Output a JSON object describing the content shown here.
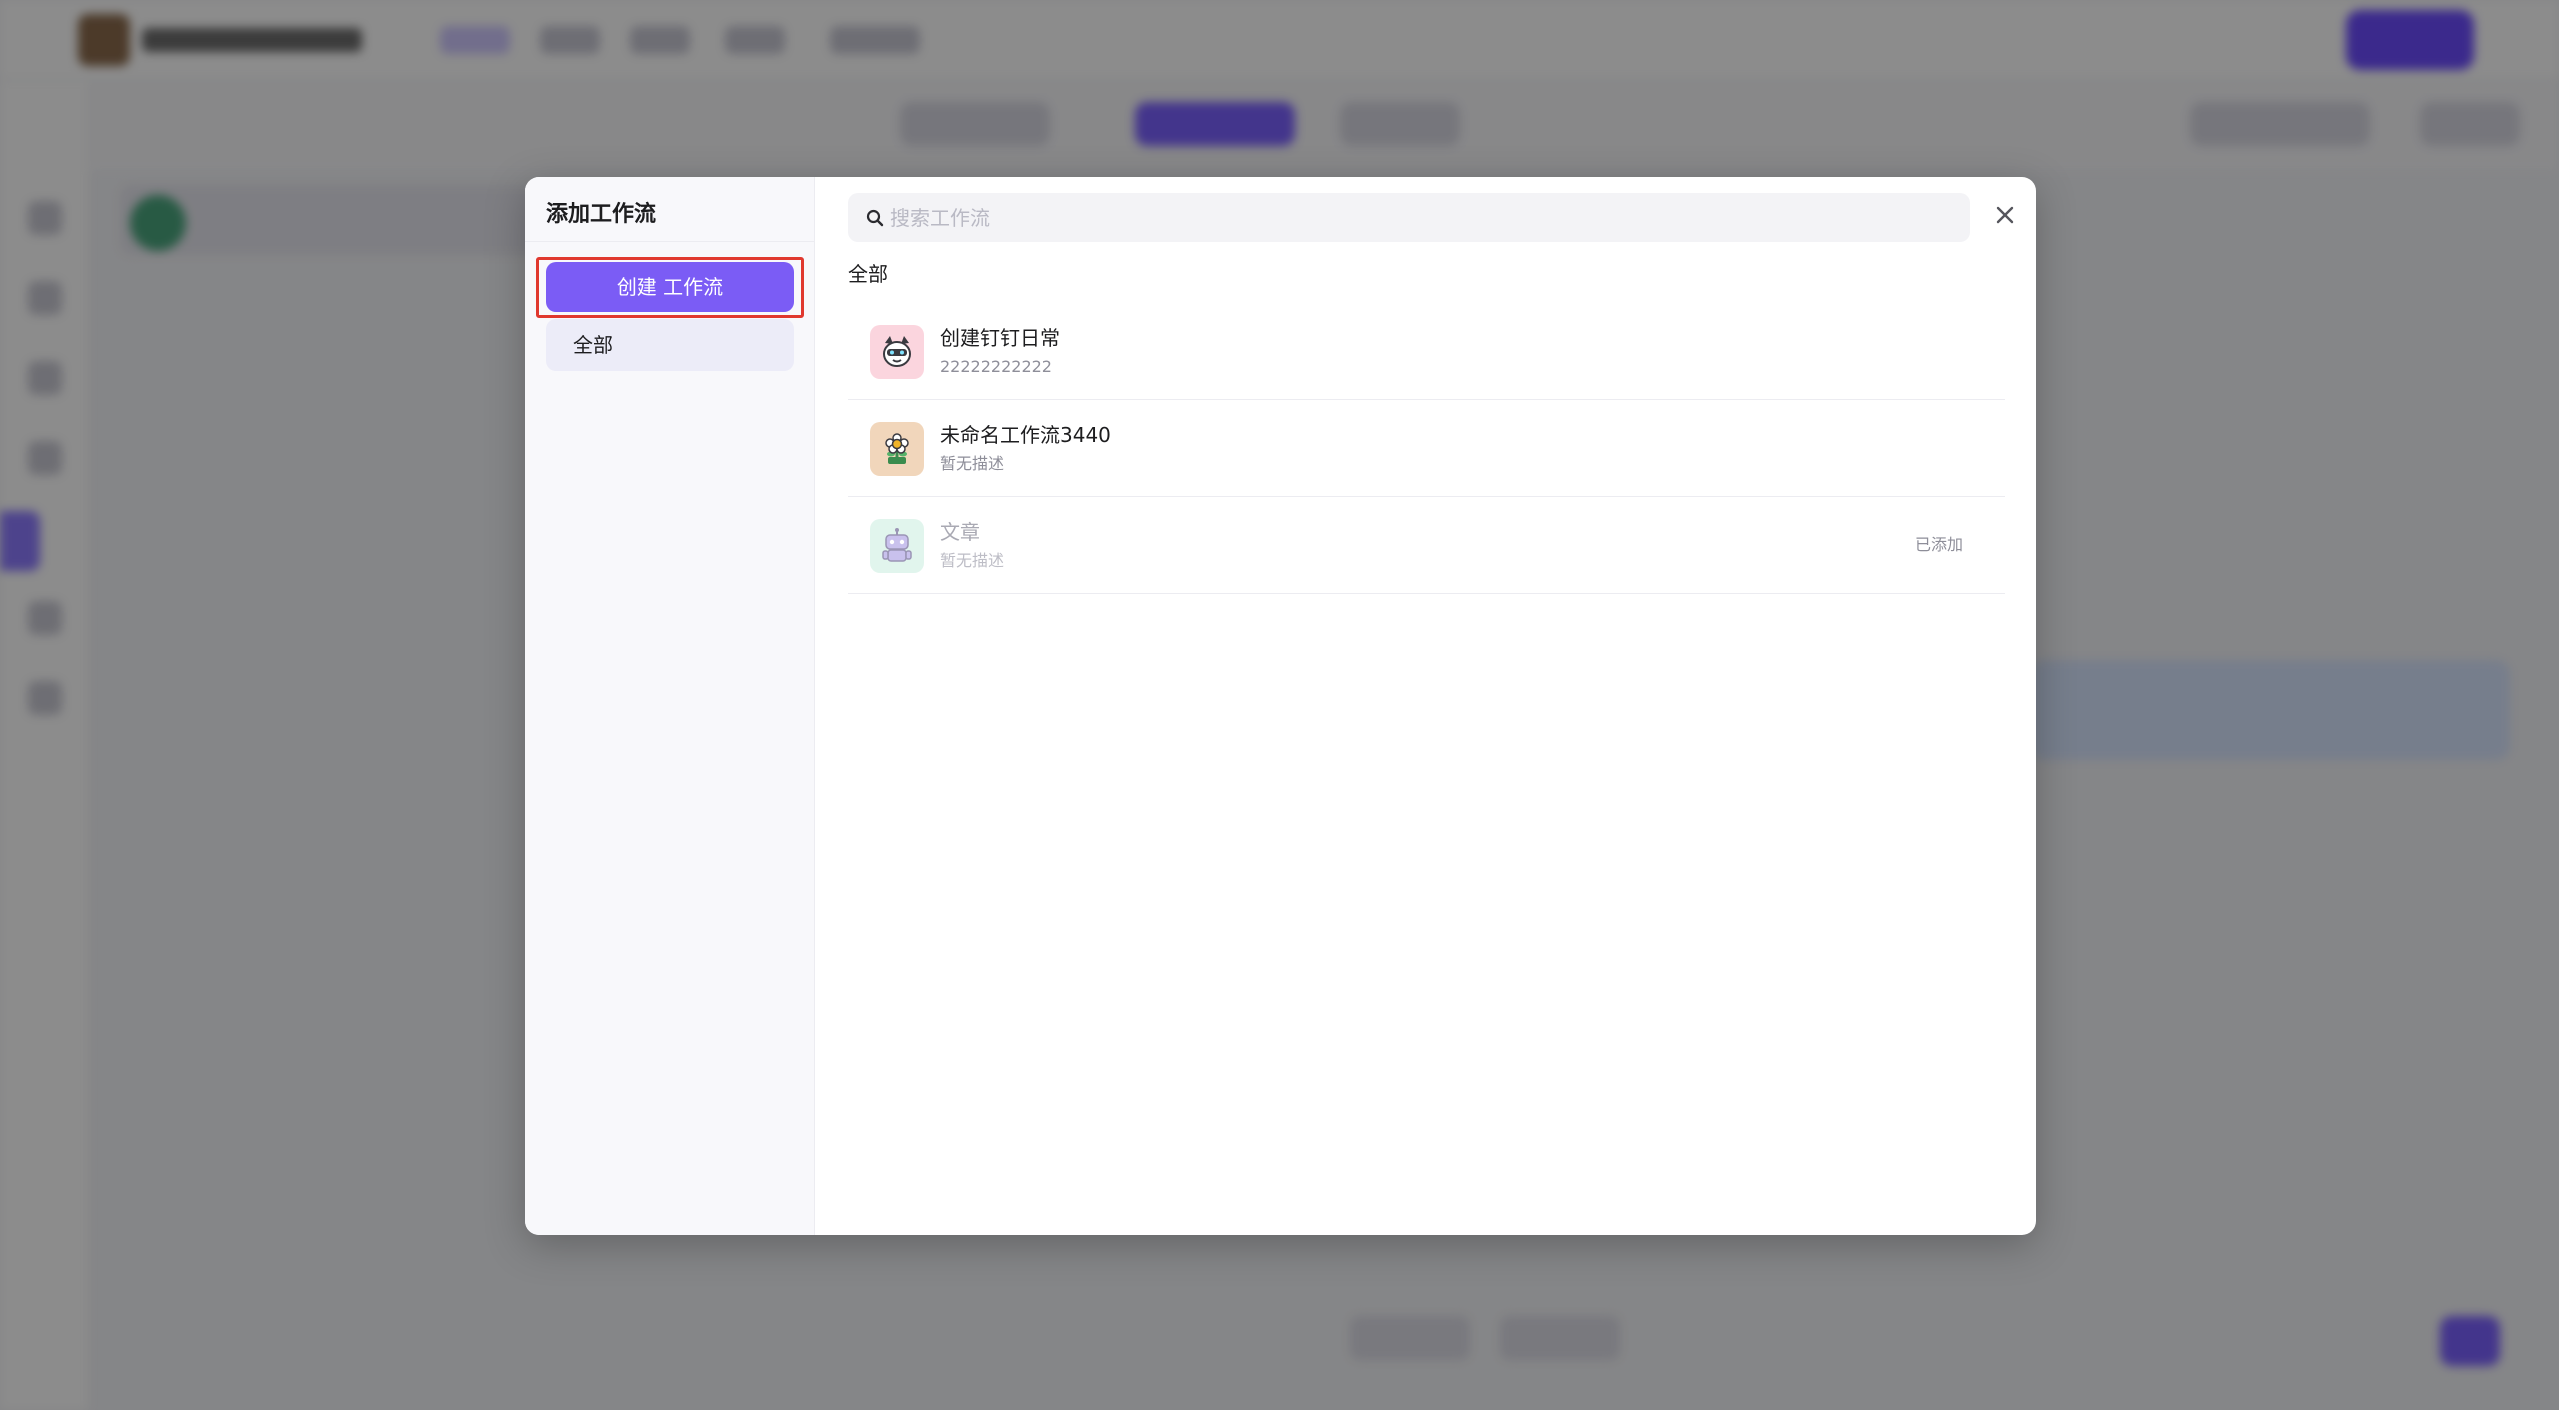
{
  "modal": {
    "title": "添加工作流",
    "create_button": "创建 工作流",
    "categories": [
      {
        "label": "全部",
        "selected": true
      }
    ],
    "search": {
      "placeholder": "搜索工作流",
      "value": ""
    },
    "close_icon": "close-icon",
    "section_title": "全部",
    "workflows": [
      {
        "name": "创建钉钉日常",
        "description": "22222222222",
        "icon": "cat-mascot-icon",
        "icon_bg": "#fbd5de",
        "status": ""
      },
      {
        "name": "未命名工作流3440",
        "description": "暂无描述",
        "icon": "flower-icon",
        "icon_bg": "#f1d6bb",
        "status": ""
      },
      {
        "name": "文章",
        "description": "暂无描述",
        "icon": "robot-icon",
        "icon_bg": "#c9eedf",
        "status": "已添加"
      }
    ]
  },
  "colors": {
    "accent": "#7b5cf5",
    "highlight_border": "#e0382e",
    "overlay": "rgba(0,0,0,0.45)"
  }
}
